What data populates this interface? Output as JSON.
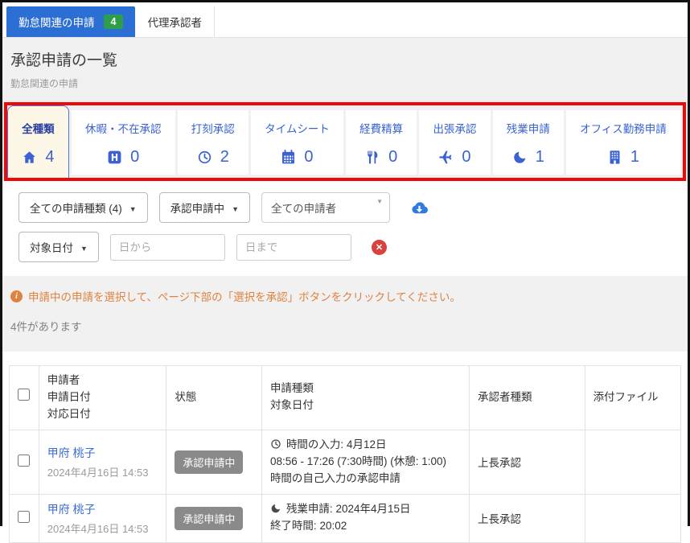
{
  "top_tabs": [
    {
      "label": "勤怠関連の申請",
      "badge": "4",
      "active": true
    },
    {
      "label": "代理承認者",
      "active": false
    }
  ],
  "header": {
    "title": "承認申請の一覧",
    "subtitle": "勤怠関連の申請"
  },
  "category_tabs": [
    {
      "label": "全種類",
      "icon": "home-icon",
      "count": "4",
      "active": true
    },
    {
      "label": "休暇・不在承認",
      "icon": "h-square-icon",
      "count": "0",
      "active": false
    },
    {
      "label": "打刻承認",
      "icon": "clock-icon",
      "count": "2",
      "active": false
    },
    {
      "label": "タイムシート",
      "icon": "calendar-icon",
      "count": "0",
      "active": false
    },
    {
      "label": "経費精算",
      "icon": "utensils-icon",
      "count": "0",
      "active": false
    },
    {
      "label": "出張承認",
      "icon": "plane-icon",
      "count": "0",
      "active": false
    },
    {
      "label": "残業申請",
      "icon": "moon-icon",
      "count": "1",
      "active": false
    },
    {
      "label": "オフィス勤務申請",
      "icon": "building-icon",
      "count": "1",
      "active": false
    }
  ],
  "filters": {
    "type_dropdown": "全ての申請種類 (4)",
    "status_dropdown": "承認申請中",
    "applicant_dropdown": "全ての申請者",
    "date_type_dropdown": "対象日付",
    "date_from_placeholder": "日から",
    "date_to_placeholder": "日まで"
  },
  "info": {
    "message": "申請中の申請を選択して、ページ下部の「選択を承認」ボタンをクリックしてください。",
    "count_text": "4件があります"
  },
  "table": {
    "columns": [
      [],
      [
        "申請者",
        "申請日付",
        "対応日付"
      ],
      [
        "状態"
      ],
      [
        "申請種類",
        "対象日付"
      ],
      [
        "承認者種類"
      ],
      [
        "添付ファイル"
      ]
    ],
    "rows": [
      {
        "applicant": "甲府 桃子",
        "applied_date": "2024年4月16日 14:53",
        "status": "承認申請中",
        "type_icon": "clock-icon",
        "type_lines": [
          "時間の入力: 4月12日",
          "08:56 - 17:26 (7:30時間) (休憩: 1:00)",
          "時間の自己入力の承認申請"
        ],
        "approver_type": "上長承認",
        "attachment": ""
      },
      {
        "applicant": "甲府 桃子",
        "applied_date": "2024年4月16日 14:53",
        "status": "承認申請中",
        "type_icon": "moon-icon",
        "type_lines": [
          "残業申請: 2024年4月15日",
          "終了時間: 20:02"
        ],
        "approver_type": "上長承認",
        "attachment": ""
      }
    ]
  },
  "colors": {
    "primary_blue": "#2c6fd4",
    "badge_green": "#2e9e4b",
    "category_blue": "#3b62d2",
    "annotation_red": "#ee0808",
    "active_tab_bg": "#fdf7e7",
    "info_orange": "#e0823f",
    "link_blue": "#3b6bd6",
    "status_badge_gray": "#8a8a8a",
    "error_red": "#d9413d"
  }
}
